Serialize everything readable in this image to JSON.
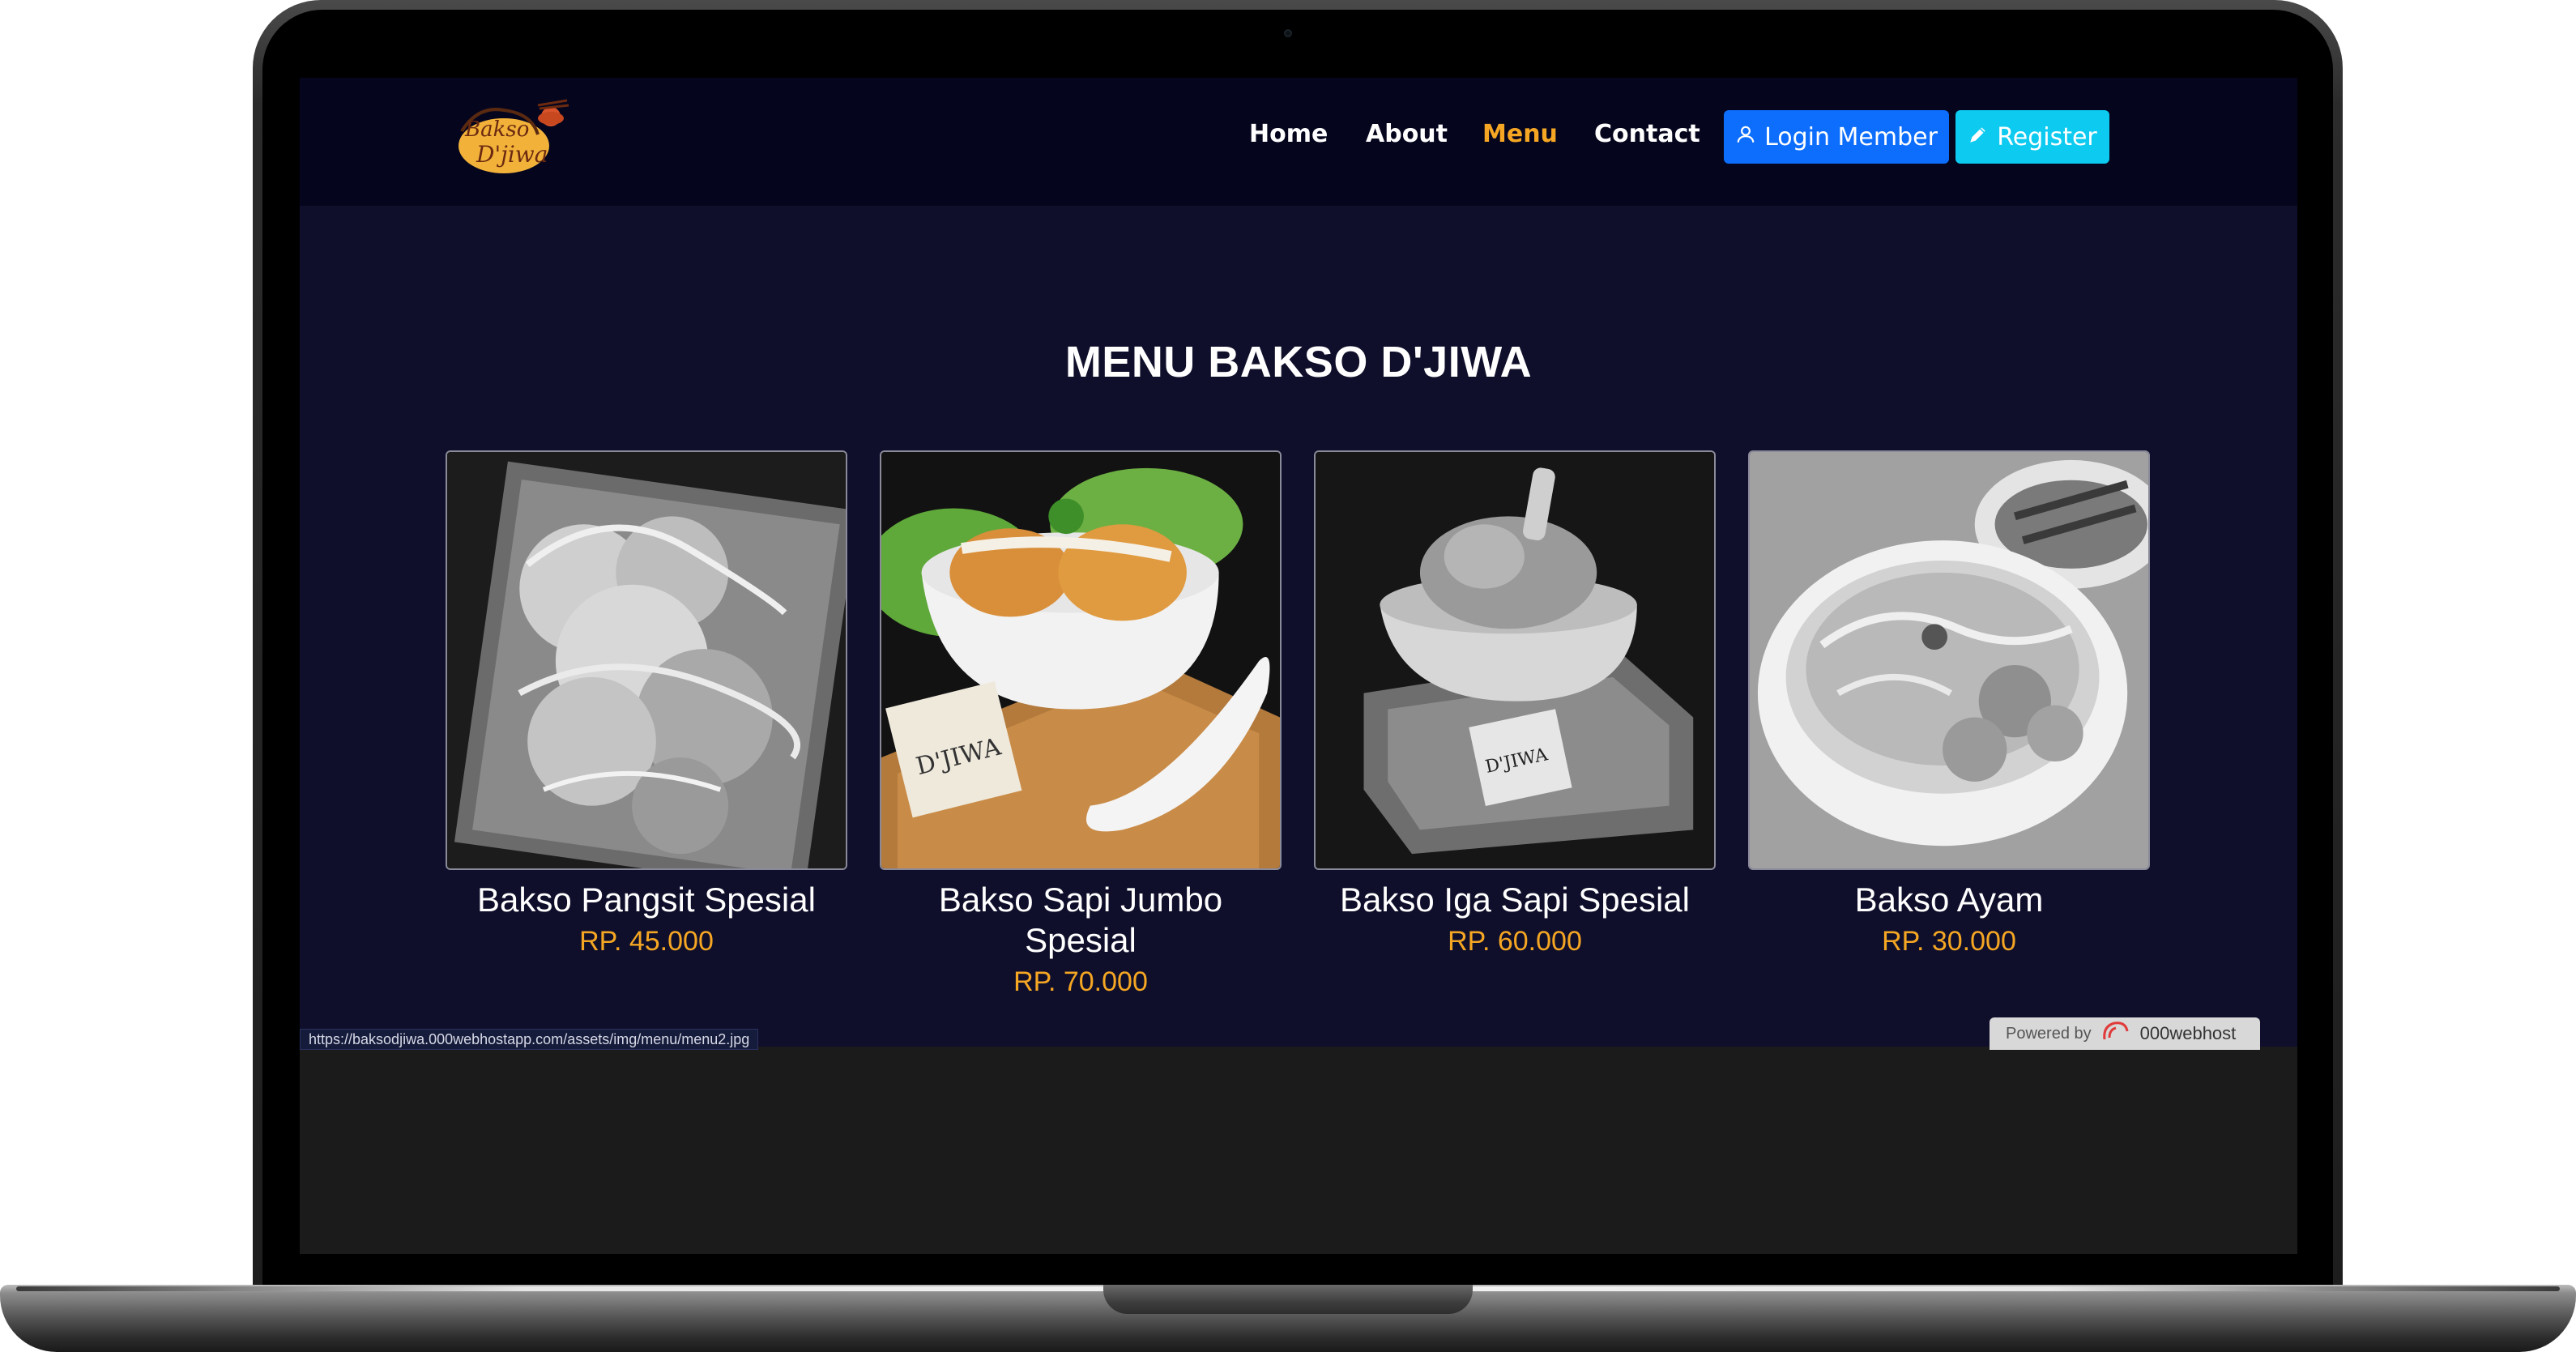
{
  "site": {
    "logo_text": "Bakso D'jiwa",
    "nav": {
      "home": "Home",
      "about": "About",
      "menu": "Menu",
      "contact": "Contact",
      "login": "Login Member",
      "register": "Register"
    },
    "title": "MENU BAKSO D'JIWA",
    "items": [
      {
        "name": "Bakso Pangsit Spesial",
        "price": "RP. 45.000"
      },
      {
        "name": "Bakso Sapi Jumbo Spesial",
        "price": "RP. 70.000"
      },
      {
        "name": "Bakso Iga Sapi Spesial",
        "price": "RP. 60.000"
      },
      {
        "name": "Bakso Ayam",
        "price": "RP. 30.000"
      }
    ],
    "status_url": "https://baksodjiwa.000webhostapp.com/assets/img/menu/menu2.jpg",
    "powered_by": "Powered by",
    "powered_brand": "000webhost"
  },
  "colors": {
    "navbar": "#05051e",
    "page_bg": "#0f0f2b",
    "accent": "#f5a623",
    "login_button": "#0d6efd",
    "register_button": "#0dcaf0"
  },
  "icons": {
    "login": "user-icon",
    "register": "pencil-icon"
  }
}
